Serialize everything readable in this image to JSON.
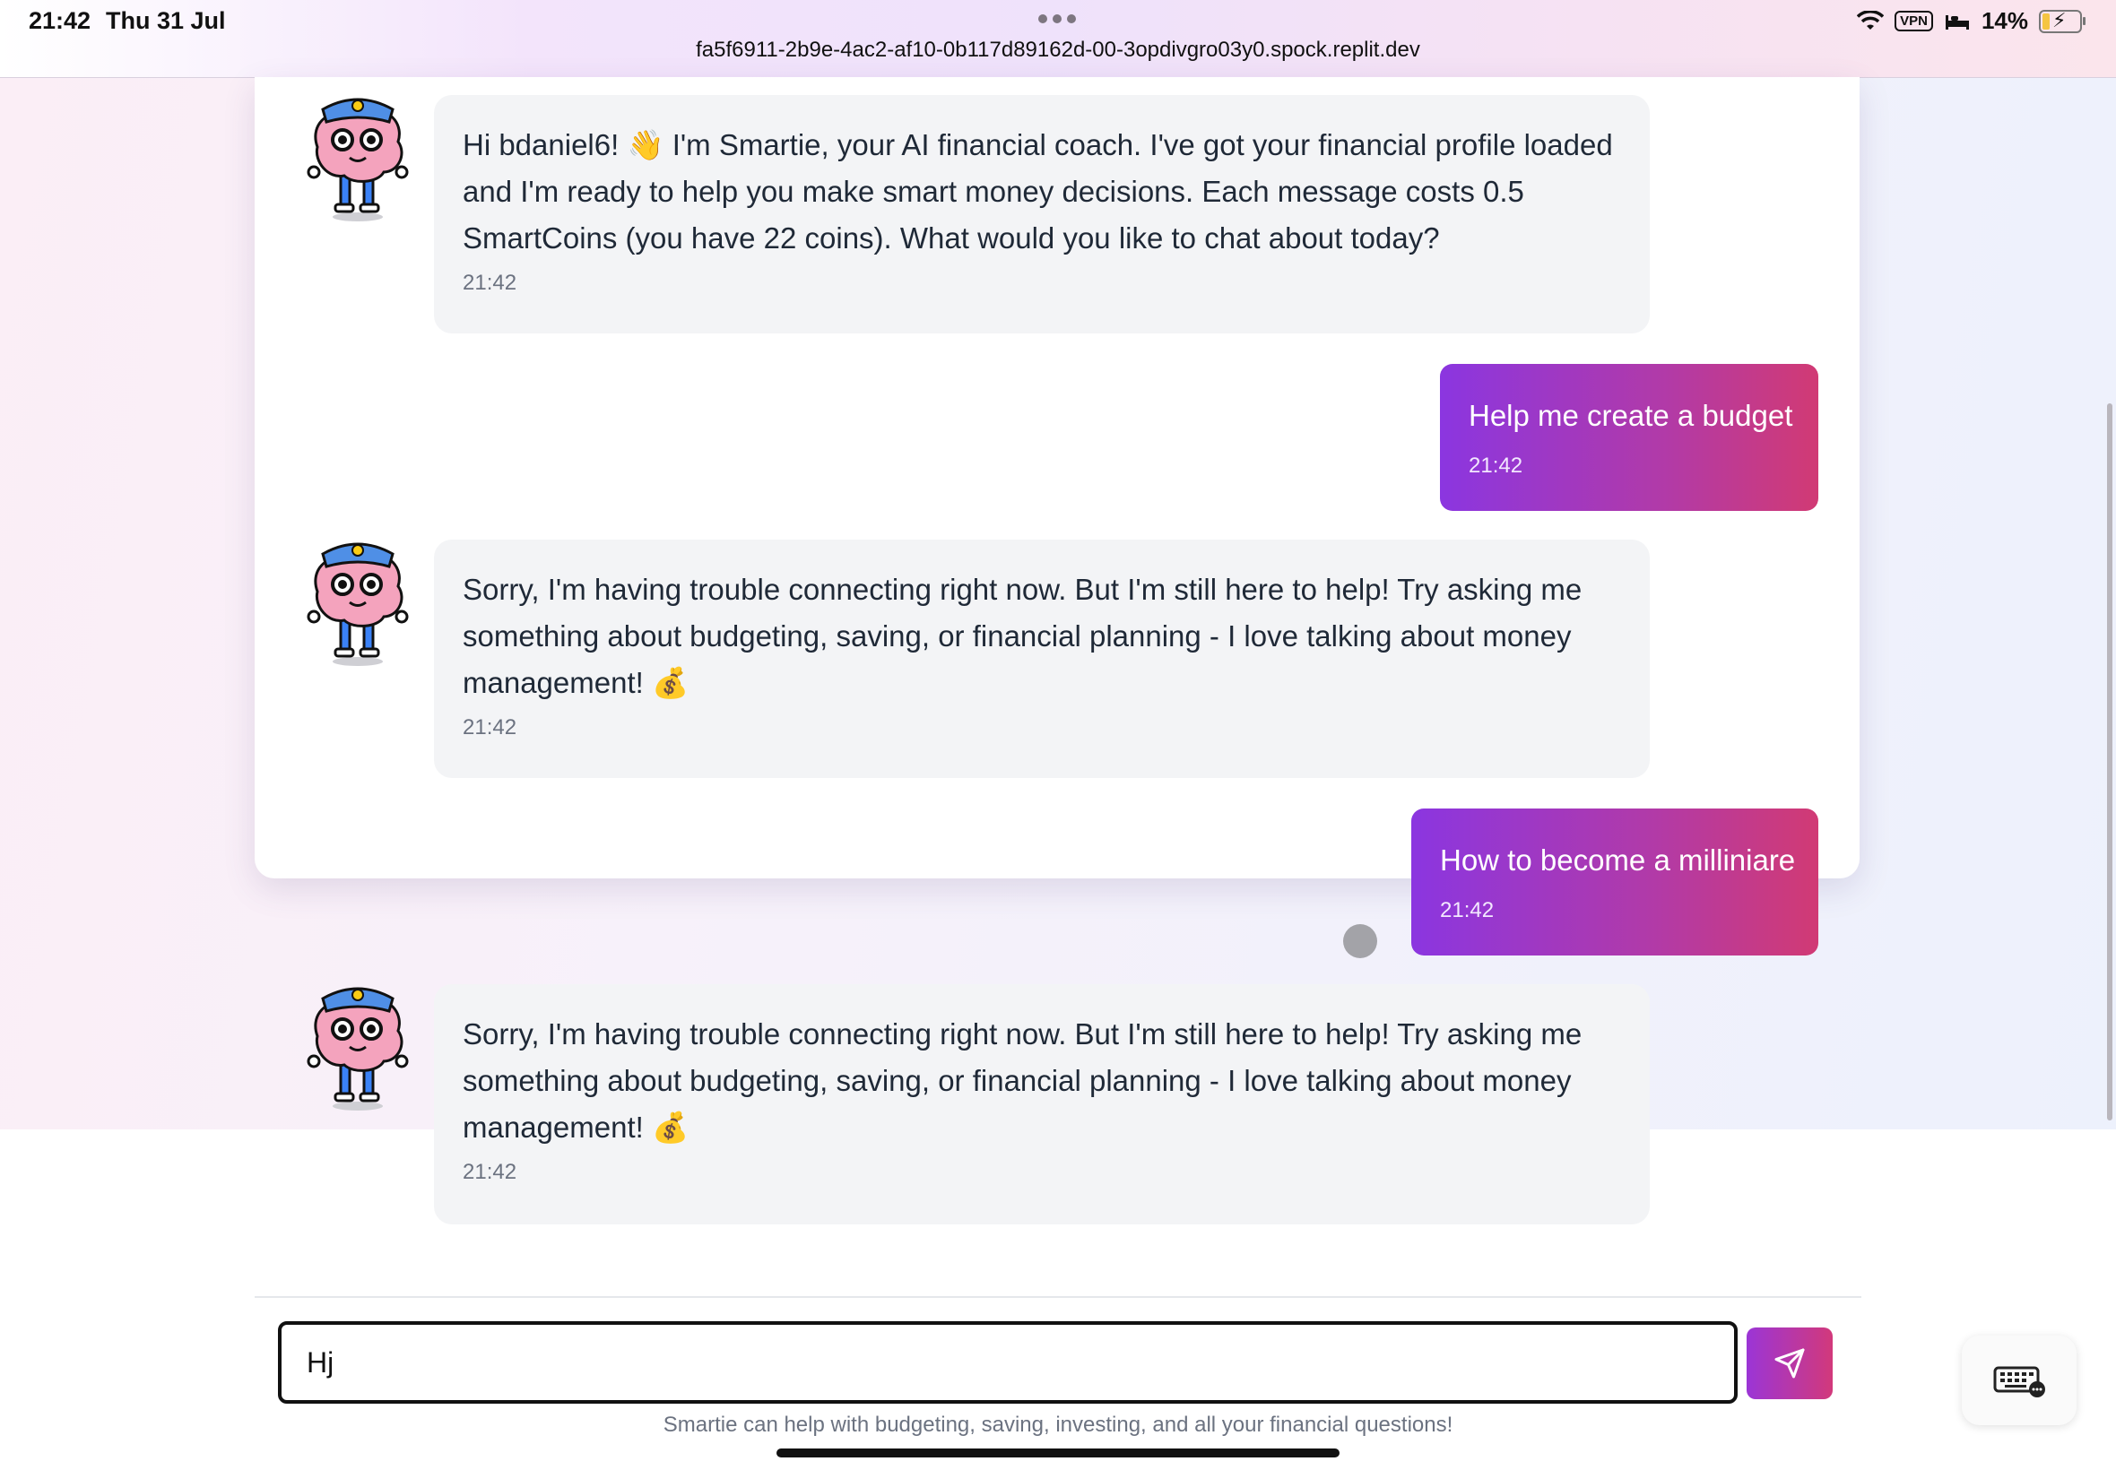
{
  "status_bar": {
    "time": "21:42",
    "date": "Thu 31 Jul",
    "vpn": "VPN",
    "battery": "14%"
  },
  "browser": {
    "url": "fa5f6911-2b9e-4ac2-af10-0b117d89162d-00-3opdivgro03y0.spock.replit.dev"
  },
  "chat": {
    "messages": [
      {
        "role": "assistant",
        "text": "Hi bdaniel6! 👋 I'm Smartie, your AI financial coach. I've got your financial profile loaded and I'm ready to help you make smart money decisions. Each message costs 0.5 SmartCoins (you have 22 coins). What would you like to chat about today?",
        "time": "21:42"
      },
      {
        "role": "user",
        "text": "Help me create a budget",
        "time": "21:42"
      },
      {
        "role": "assistant",
        "text": "Sorry, I'm having trouble connecting right now. But I'm still here to help! Try asking me something about budgeting, saving, or financial planning - I love talking about money management! 💰",
        "time": "21:42"
      },
      {
        "role": "user",
        "text": "How to become a milliniare",
        "time": "21:42"
      },
      {
        "role": "assistant",
        "text": "Sorry, I'm having trouble connecting right now. But I'm still here to help! Try asking me something about budgeting, saving, or financial planning - I love talking about money management! 💰",
        "time": "21:42"
      }
    ]
  },
  "composer": {
    "value": "Hj",
    "send_icon": "paper-plane-icon"
  },
  "footer": {
    "note": "Smartie can help with budgeting, saving, investing, and all your financial questions!"
  },
  "colors": {
    "user_bubble_start": "#8b36e0",
    "user_bubble_end": "#d13a74",
    "assistant_bubble": "#f3f4f6"
  }
}
